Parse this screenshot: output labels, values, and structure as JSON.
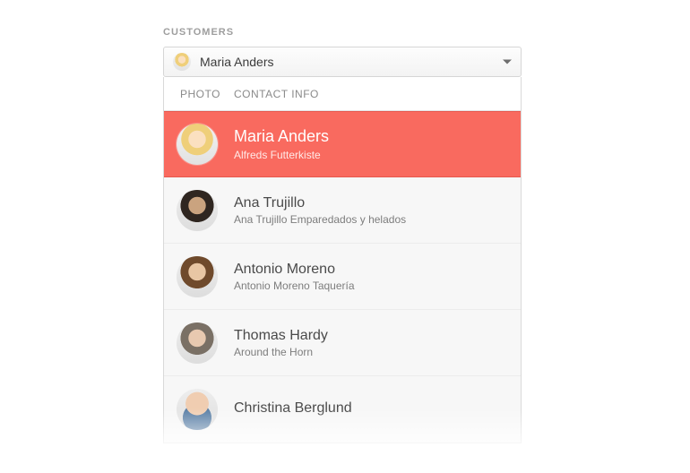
{
  "label": "CUSTOMERS",
  "selected": {
    "name": "Maria Anders",
    "avatarClass": "av-blonde"
  },
  "columns": {
    "photo": "PHOTO",
    "contact": "CONTACT INFO"
  },
  "colors": {
    "accent": "#f96a5f"
  },
  "items": [
    {
      "name": "Maria Anders",
      "company": "Alfreds Futterkiste",
      "avatarClass": "av-blonde",
      "selected": true
    },
    {
      "name": "Ana Trujillo",
      "company": "Ana Trujillo Emparedados y helados",
      "avatarClass": "av-dark",
      "selected": false
    },
    {
      "name": "Antonio Moreno",
      "company": "Antonio Moreno Taquería",
      "avatarClass": "av-brown",
      "selected": false
    },
    {
      "name": "Thomas Hardy",
      "company": "Around the Horn",
      "avatarClass": "av-grey",
      "selected": false
    },
    {
      "name": "Christina Berglund",
      "company": "",
      "avatarClass": "av-bald",
      "selected": false
    }
  ]
}
